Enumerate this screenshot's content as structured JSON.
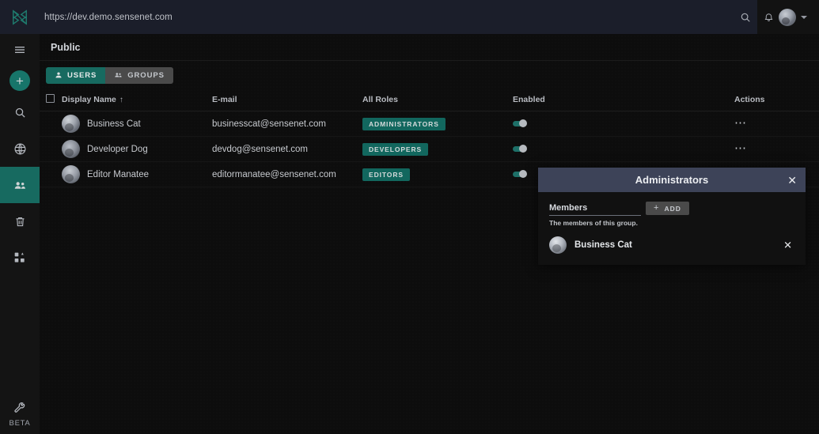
{
  "browser": {
    "url": "https://dev.demo.sensenet.com",
    "logo_icon": "sensenet-logo-icon",
    "search_icon": "search-icon",
    "notifications_icon": "bell-icon",
    "avatar_icon": "user-avatar",
    "account_chevron_icon": "chevron-down-icon"
  },
  "sidebar": {
    "menu_icon": "hamburger-menu-icon",
    "add_label": "+",
    "items": [
      {
        "icon": "search-icon",
        "name": "search",
        "active": false
      },
      {
        "icon": "globe-icon",
        "name": "content",
        "active": false
      },
      {
        "icon": "users-group-icon",
        "name": "users-and-groups",
        "active": true
      },
      {
        "icon": "trash-icon",
        "name": "trash",
        "active": false
      },
      {
        "icon": "apps-grid-icon",
        "name": "apps",
        "active": false
      }
    ],
    "settings_icon": "wrench-icon",
    "beta_label": "BETA"
  },
  "breadcrumb": {
    "label": "Public"
  },
  "tabs": [
    {
      "label": "USERS",
      "icon": "person-icon",
      "active": true
    },
    {
      "label": "GROUPS",
      "icon": "group-icon",
      "active": false
    }
  ],
  "table": {
    "columns": [
      "Display Name",
      "E-mail",
      "All Roles",
      "Enabled",
      "Actions"
    ],
    "sort_column": "Display Name",
    "sort_direction_icon": "arrow-up-icon",
    "select_all_checked": false,
    "rows": [
      {
        "display_name": "Business Cat",
        "email": "businesscat@sensenet.com",
        "role": "ADMINISTRATORS",
        "enabled": true,
        "actions_icon": "more-horizontal-icon"
      },
      {
        "display_name": "Developer Dog",
        "email": "devdog@sensenet.com",
        "role": "DEVELOPERS",
        "enabled": true,
        "actions_icon": "more-horizontal-icon"
      },
      {
        "display_name": "Editor Manatee",
        "email": "editormanatee@sensenet.com",
        "role": "EDITORS",
        "enabled": true,
        "actions_icon": "more-horizontal-icon"
      }
    ]
  },
  "modal": {
    "title": "Administrators",
    "close_icon": "close-icon",
    "members_label": "Members",
    "add_button_label": "ADD",
    "add_button_icon": "plus-icon",
    "helper_text": "The members of this group.",
    "members": [
      {
        "name": "Business Cat",
        "remove_icon": "close-icon"
      }
    ]
  },
  "colors": {
    "accent_teal": "#176a60",
    "chip_teal": "#12675e",
    "topbar_bg": "#1b1e2a",
    "modal_header_bg": "#3d4358",
    "page_bg": "#0d0d0d",
    "rail_bg": "#141414"
  }
}
